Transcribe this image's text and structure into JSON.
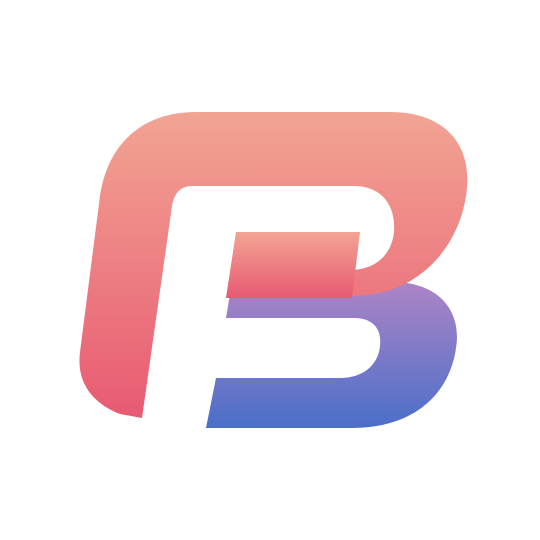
{
  "logo": {
    "icon": "fb-monogram-logo",
    "colors": {
      "background": "#ffffff",
      "top_gradient_start": "#f2a493",
      "top_gradient_end": "#e85a72",
      "bottom_gradient_start": "#ae84c6",
      "bottom_gradient_end": "#4a6fc9"
    }
  }
}
